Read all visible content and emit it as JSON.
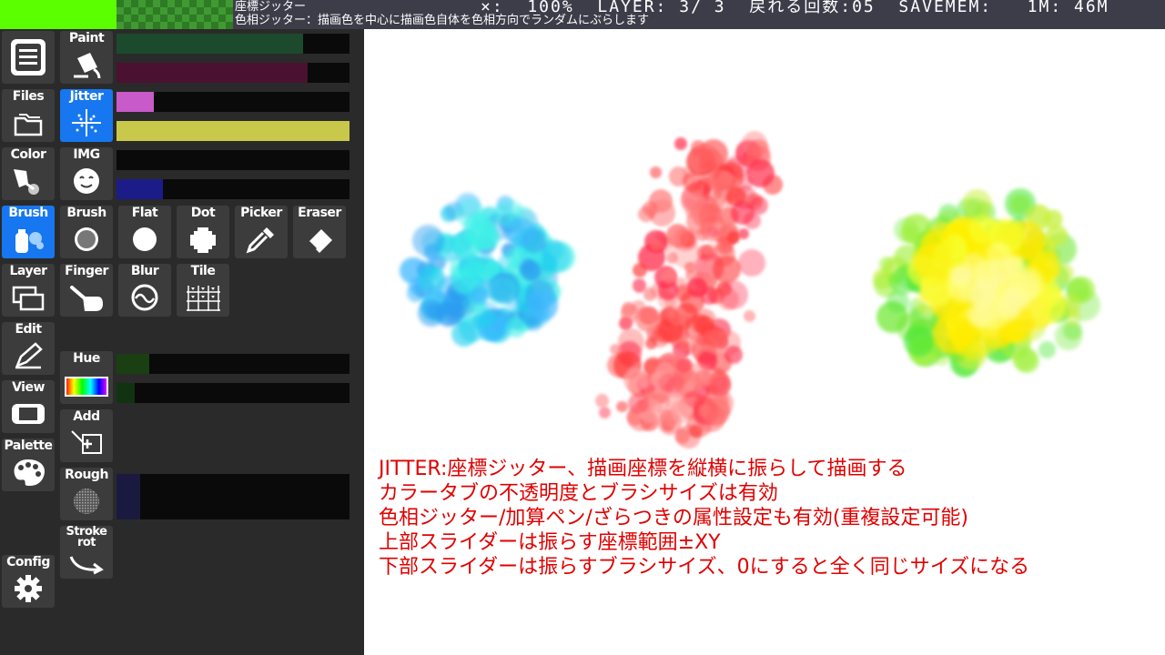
{
  "topbar": {
    "tool_name": "座標ジッター",
    "tool_description": "色相ジッター：描画色を中心に描画色自体を色相方向でランダムにぶらします",
    "status": "×:  100%  LAYER: 3/ 3  戻れる回数:05  SAVEMEM:   1M: 46M",
    "swatch_color": "#5cff00"
  },
  "side_menu": [
    {
      "id": "menu",
      "label": "",
      "icon": "menu-icon"
    },
    {
      "id": "files",
      "label": "Files",
      "icon": "folder-icon"
    },
    {
      "id": "color",
      "label": "Color",
      "icon": "paint-tube-icon"
    },
    {
      "id": "brush",
      "label": "Brush",
      "icon": "spray-icon",
      "active": true
    },
    {
      "id": "layer",
      "label": "Layer",
      "icon": "layers-icon"
    },
    {
      "id": "edit",
      "label": "Edit",
      "icon": "pen-icon"
    },
    {
      "id": "view",
      "label": "View",
      "icon": "gamepad-icon"
    },
    {
      "id": "palette",
      "label": "Palette",
      "icon": "palette-icon"
    },
    {
      "id": "config",
      "label": "Config",
      "icon": "gear-icon"
    }
  ],
  "tool_buttons": {
    "paint": "Paint",
    "jitter": "Jitter",
    "img": "IMG",
    "brush": "Brush",
    "flat": "Flat",
    "dot": "Dot",
    "picker": "Picker",
    "eraser": "Eraser",
    "finger": "Finger",
    "blur": "Blur",
    "tile": "Tile",
    "hue": "Hue",
    "add": "Add",
    "rough": "Rough",
    "stroke_rot": "Stroke\nrot"
  },
  "sliders": {
    "paint_top": {
      "level": 0.8,
      "color": "#1c4a2c"
    },
    "paint_bottom": {
      "level": 0.82,
      "color": "#4a1230"
    },
    "jitter_top": {
      "level": 0.16,
      "color": "#c95ac9"
    },
    "jitter_bottom": {
      "level": 1.0,
      "color": "#c8c84a"
    },
    "img_top": {
      "level": 0.0,
      "color": "#1a1a1a"
    },
    "img_bottom": {
      "level": 0.2,
      "color": "#1c1c88"
    },
    "hue_top": {
      "level": 0.14,
      "color": "#1a3f12"
    },
    "hue_bottom": {
      "level": 0.08,
      "color": "#123312"
    },
    "rough": {
      "level": 0.1,
      "color": "#1a1a40"
    }
  },
  "notes": [
    "JITTER:座標ジッター、描画座標を縦横に振らして描画する",
    "カラータブの不透明度とブラシサイズは有効",
    "色相ジッター/加算ペン/ざらつきの属性設定も有効(重複設定可能)",
    "上部スライダーは振らす座標範囲±XY",
    "下部スライダーは振らすブラシサイズ、0にすると全く同じサイズになる"
  ],
  "colors": {
    "panel_bg": "#2a2a2a",
    "button_bg": "#3c3c3c",
    "active_bg": "#1677f0",
    "note_text": "#e00000",
    "blob_cyan": "#22d0f0",
    "blob_red": "#ff3a3a",
    "blob_yellow": "#ffef00",
    "blob_green": "#6ee830"
  }
}
